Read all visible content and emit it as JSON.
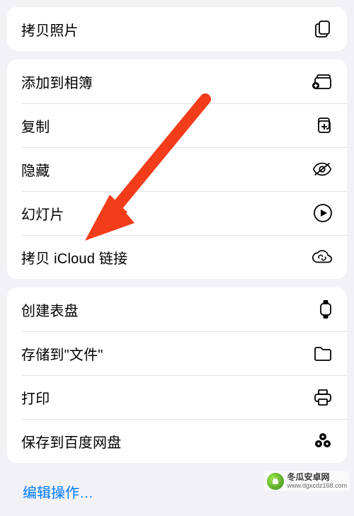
{
  "groups": [
    {
      "rows": [
        {
          "label": "拷贝照片",
          "icon": "copy-photo-icon"
        }
      ]
    },
    {
      "rows": [
        {
          "label": "添加到相簿",
          "icon": "add-to-album-icon"
        },
        {
          "label": "复制",
          "icon": "duplicate-icon"
        },
        {
          "label": "隐藏",
          "icon": "hide-icon"
        },
        {
          "label": "幻灯片",
          "icon": "slideshow-play-icon"
        },
        {
          "label": "拷贝 iCloud 链接",
          "icon": "icloud-link-icon"
        }
      ]
    },
    {
      "rows": [
        {
          "label": "创建表盘",
          "icon": "watch-face-icon"
        },
        {
          "label": "存储到\"文件\"",
          "icon": "save-to-files-icon"
        },
        {
          "label": "打印",
          "icon": "print-icon"
        },
        {
          "label": "保存到百度网盘",
          "icon": "baidu-netdisk-icon"
        }
      ]
    }
  ],
  "edit_actions_label": "编辑操作…",
  "watermark": {
    "name": "冬瓜安卓网",
    "url": "www.dgxcdz168.com"
  },
  "arrow": {
    "color": "#f23c1a"
  }
}
